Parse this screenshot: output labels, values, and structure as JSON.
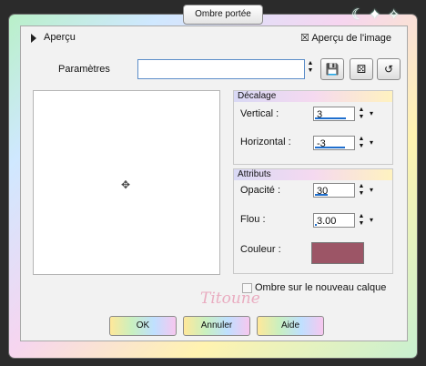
{
  "window": {
    "title": "Ombre portée"
  },
  "header": {
    "preview_toggle_label": "Aperçu",
    "preview_checkbox_label": "Aperçu de l'image",
    "preview_checkbox_mark": "☒"
  },
  "params": {
    "label": "Paramètres",
    "value": ""
  },
  "decalage": {
    "title": "Décalage",
    "vertical_label": "Vertical :",
    "vertical_value": "3",
    "horizontal_label": "Horizontal :",
    "horizontal_value": "-3"
  },
  "attributs": {
    "title": "Attributs",
    "opacite_label": "Opacité :",
    "opacite_value": "30",
    "flou_label": "Flou :",
    "flou_value": "3.00",
    "couleur_label": "Couleur :",
    "couleur_color": "#9c5566"
  },
  "options": {
    "new_layer_label": "Ombre sur le nouveau calque",
    "new_layer_checked": false
  },
  "signature": {
    "text": "Titoune"
  },
  "buttons": {
    "ok": "OK",
    "cancel": "Annuler",
    "help": "Aide"
  }
}
